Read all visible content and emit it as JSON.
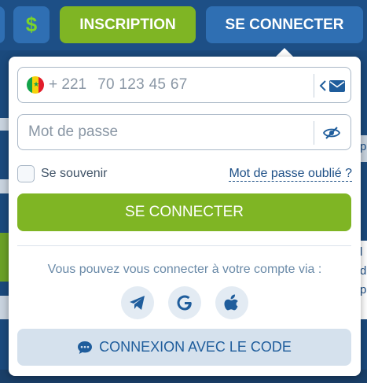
{
  "header": {
    "currency_symbol": "$",
    "inscription_label": "INSCRIPTION",
    "connect_label": "SE CONNECTER"
  },
  "background": {
    "right_text_1": "p",
    "right_text_2": "l",
    "right_text_3": "d",
    "right_text_4": "p"
  },
  "login": {
    "phone": {
      "country_flag": "senegal-flag",
      "dial_code": "+ 221",
      "value": "70 123 45 67"
    },
    "password": {
      "placeholder": "Mot de passe"
    },
    "remember_label": "Se souvenir",
    "forgot_label": "Mot de passe oublié ?",
    "submit_label": "SE CONNECTER",
    "via_text": "Vous pouvez vous connecter à votre compte via :",
    "socials": [
      "telegram-icon",
      "google-icon",
      "apple-icon"
    ],
    "code_button_label": "CONNEXION AVEC LE CODE"
  },
  "colors": {
    "header_bg": "#1d4f86",
    "accent_green": "#7fb524",
    "accent_blue": "#2f6fb3",
    "link_blue": "#1d4f86"
  }
}
